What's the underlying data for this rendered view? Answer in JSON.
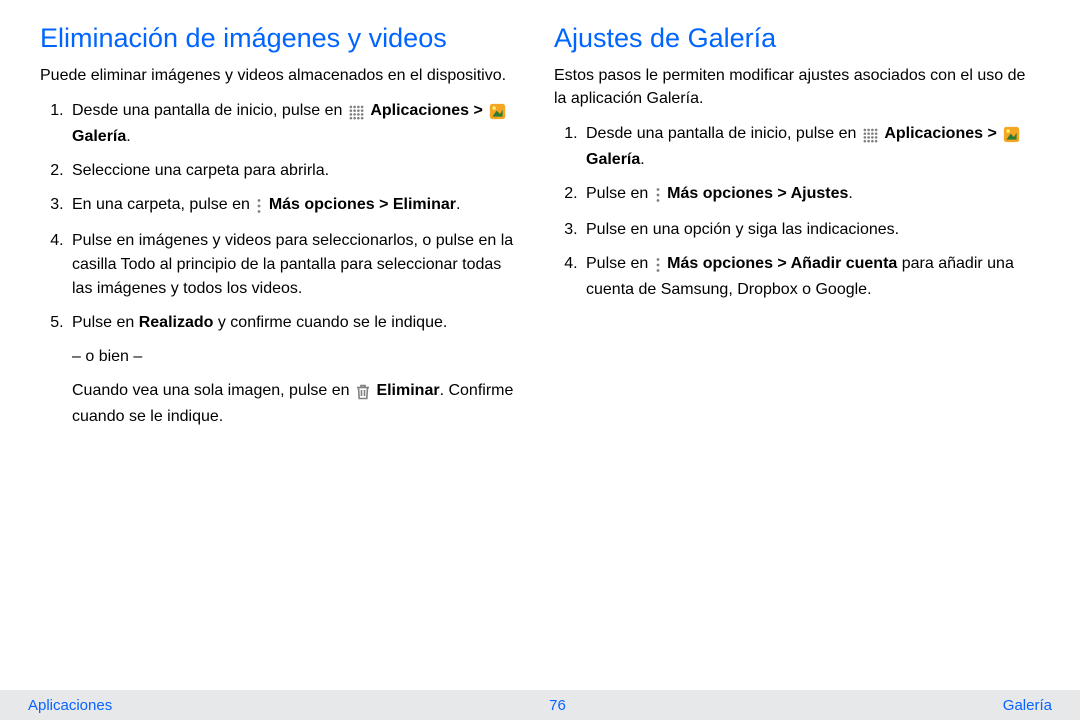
{
  "left": {
    "title": "Eliminación de imágenes y videos",
    "intro": "Puede eliminar imágenes y videos almacenados en el dispositivo.",
    "step1_a": "Desde una pantalla de inicio, pulse en ",
    "step1_apps": "Aplicaciones > ",
    "step1_gal": " Galería",
    "step1_end": ".",
    "step2": "Seleccione una carpeta para abrirla.",
    "step3_a": "En una carpeta, pulse en ",
    "step3_more": "Más opciones > Eliminar",
    "step3_end": ".",
    "step4": "Pulse en imágenes y videos para seleccionarlos, o pulse en la casilla Todo al principio de la pantalla para seleccionar todas las imágenes y todos los videos.",
    "step5_a": "Pulse en ",
    "step5_done": "Realizado",
    "step5_b": " y confirme cuando se le indique.",
    "or": "– o bien –",
    "alt_a": "Cuando vea una sola imagen, pulse en ",
    "alt_del": "Eliminar",
    "alt_b": ". Confirme cuando se le indique."
  },
  "right": {
    "title": "Ajustes de Galería",
    "intro": "Estos pasos le permiten modificar ajustes asociados con el uso de la aplicación Galería.",
    "step1_a": "Desde una pantalla de inicio, pulse en ",
    "step1_apps": "Aplicaciones > ",
    "step1_gal": " Galería",
    "step1_end": ".",
    "step2_a": "Pulse en ",
    "step2_more": "Más opciones > Ajustes",
    "step2_end": ".",
    "step3": "Pulse en una opción y siga las indicaciones.",
    "step4_a": "Pulse en ",
    "step4_more": "Más opciones > Añadir cuenta",
    "step4_b": " para añadir una cuenta de Samsung, Dropbox o Google."
  },
  "footer": {
    "left": "Aplicaciones",
    "center": "76",
    "right": "Galería"
  }
}
